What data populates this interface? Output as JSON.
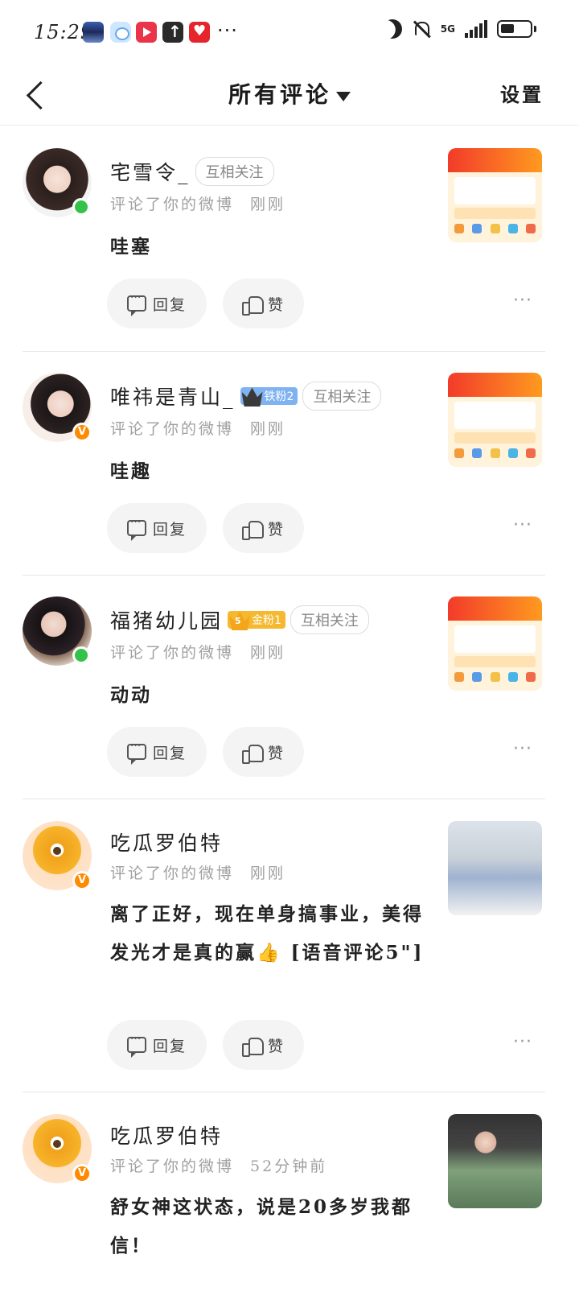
{
  "status_bar": {
    "time": "15:29",
    "more_indicator": "···",
    "network": "5G",
    "icons": [
      "wallpaper-app-icon",
      "cloud-app-icon",
      "video-app-icon",
      "upload-app-icon",
      "shopping-app-icon",
      "moon-icon",
      "bell-off-icon",
      "signal-icon",
      "battery-icon"
    ]
  },
  "nav": {
    "title": "所有评论",
    "settings_label": "设置"
  },
  "actions": {
    "reply_label": "回复",
    "like_label": "赞",
    "more_label": "···"
  },
  "comments": [
    {
      "username": "宅雪令_",
      "relation": "互相关注",
      "meta_action": "评论了你的微博",
      "time": "刚刚",
      "text": "哇塞",
      "avatar_badge": "online"
    },
    {
      "username": "唯祎是青山_",
      "fan_badge": "铁粉2",
      "relation": "互相关注",
      "meta_action": "评论了你的微博",
      "time": "刚刚",
      "text": "哇趣",
      "avatar_badge": "v"
    },
    {
      "username": "福猪幼儿园",
      "fan_badge_level": "5",
      "fan_badge": "金粉1",
      "relation": "互相关注",
      "meta_action": "评论了你的微博",
      "time": "刚刚",
      "text": "动动",
      "avatar_badge": "online"
    },
    {
      "username": "吃瓜罗伯特",
      "meta_action": "评论了你的微博",
      "time": "刚刚",
      "text": "离了正好，现在单身搞事业，美得发光才是真的赢👍 [语音评论5\"]",
      "avatar_badge": "v"
    },
    {
      "username": "吃瓜罗伯特",
      "meta_action": "评论了你的微博",
      "time": "52分钟前",
      "text": "舒女神这状态，说是20多岁我都信！",
      "avatar_badge": "v"
    }
  ],
  "colors": {
    "online_badge": "#35c24a",
    "verified_badge": "#ff8a00",
    "iron_fan": "#7fb2f0",
    "gold_fan": "#f5b82e"
  }
}
